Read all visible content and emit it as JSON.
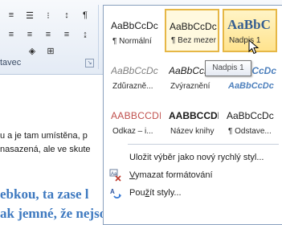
{
  "ribbon": {
    "group_label": "tavec",
    "launcher_glyph": "↘",
    "row1": [
      {
        "name": "line-spacing-icon",
        "glyph": "≡"
      },
      {
        "name": "bullets-icon",
        "glyph": "☰"
      },
      {
        "name": "numbering-icon",
        "glyph": "⁝"
      },
      {
        "name": "sort-icon",
        "glyph": "↕"
      },
      {
        "name": "pilcrow-icon",
        "glyph": "¶"
      }
    ],
    "row2": [
      {
        "name": "align-left-icon",
        "glyph": "≡"
      },
      {
        "name": "align-center-icon",
        "glyph": "≡"
      },
      {
        "name": "align-right-icon",
        "glyph": "≡"
      },
      {
        "name": "justify-icon",
        "glyph": "≡"
      },
      {
        "name": "spacing-icon",
        "glyph": "↨"
      }
    ],
    "row3": [
      {
        "name": "shading-icon",
        "glyph": "◈"
      },
      {
        "name": "borders-icon",
        "glyph": "⊞"
      }
    ]
  },
  "document": {
    "line1": "u a je tam umístěna, p",
    "line2": "nasazená, ale ve skute",
    "line3": "ebkou, ta zase l",
    "line4": "ak jemné, že nejsou žádné."
  },
  "gallery": {
    "tiles": [
      {
        "preview": "AaBbCcDc",
        "name": "¶ Normální",
        "color": "#1a1a1a",
        "style": "normal"
      },
      {
        "preview": "AaBbCcDc",
        "name": "¶ Bez mezer",
        "color": "#1a1a1a",
        "style": "normal"
      },
      {
        "preview": "AaBbC",
        "name": "Nadpis 1",
        "color": "#365f91",
        "style": "heading"
      },
      {
        "preview": "AaBbCcDc",
        "name": "Zdůrazně...",
        "color": "#7f7f7f",
        "style": "italic"
      },
      {
        "preview": "AaBbCcDc",
        "name": "Zvýraznění",
        "color": "#1a1a1a",
        "style": "italic"
      },
      {
        "preview": "AaBbCcDc",
        "name": "AaBbCcDc",
        "color": "#4f81bd",
        "style": "italic-bold"
      },
      {
        "preview": "AABBCCDD",
        "name": "Odkaz – i...",
        "color": "#c0504d",
        "style": "caps"
      },
      {
        "preview": "AABBCCDD",
        "name": "Název knihy",
        "color": "#1a1a1a",
        "style": "caps-bold"
      },
      {
        "preview": "AaBbCcDc",
        "name": "¶ Odstave...",
        "color": "#1a1a1a",
        "style": "normal"
      }
    ],
    "menu": [
      {
        "label": "Uložit výběr jako nový rychlý styl...",
        "hotkey_index": -1,
        "icon": ""
      },
      {
        "label": "Vymazat formátování",
        "hotkey_index": 0,
        "icon": "clear-formatting-icon"
      },
      {
        "label": "Použít styly...",
        "hotkey_index": 3,
        "icon": "apply-styles-icon"
      }
    ]
  },
  "tooltip": "Nadpis 1",
  "colors": {
    "accent_border": "#e6b746",
    "heading_blue": "#365f91",
    "doc_heading_blue": "#3f7ac0"
  }
}
